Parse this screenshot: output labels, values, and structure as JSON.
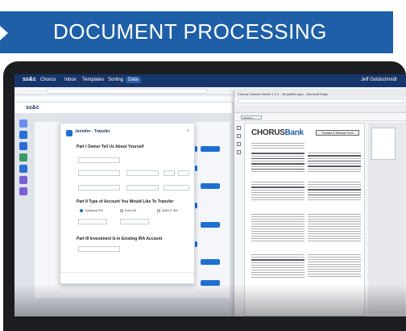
{
  "banner": {
    "title": "DOCUMENT PROCESSING"
  },
  "app_nav": {
    "brand": "ss&c",
    "product": "Chorus",
    "items": [
      "Inbox",
      "Templates",
      "Sorting",
      "Data"
    ],
    "active": "Data",
    "user": "Jeff Goldschmidt"
  },
  "modal": {
    "title": "Jennifer - Transfer",
    "section1": "Part I Owner Tell Us About Yourself",
    "section2": "Part II Type of Account You Would Like To Transfer",
    "section3": "Part III Investment Is In Existing IRA Account",
    "radio_labels": [
      "Traditional IRA",
      "Roth IRA",
      "SIMPLE IRA"
    ]
  },
  "viewer": {
    "window_title": "Chorus Content Viewer 1.0.1 - Simplified.aspx - Microsoft Edge",
    "page_label": "1/9/2024 1",
    "doc_brand_part1": "CHORUS",
    "doc_brand_part2": "Bank",
    "doc_box_label": "Transfer & Rollover Form"
  }
}
